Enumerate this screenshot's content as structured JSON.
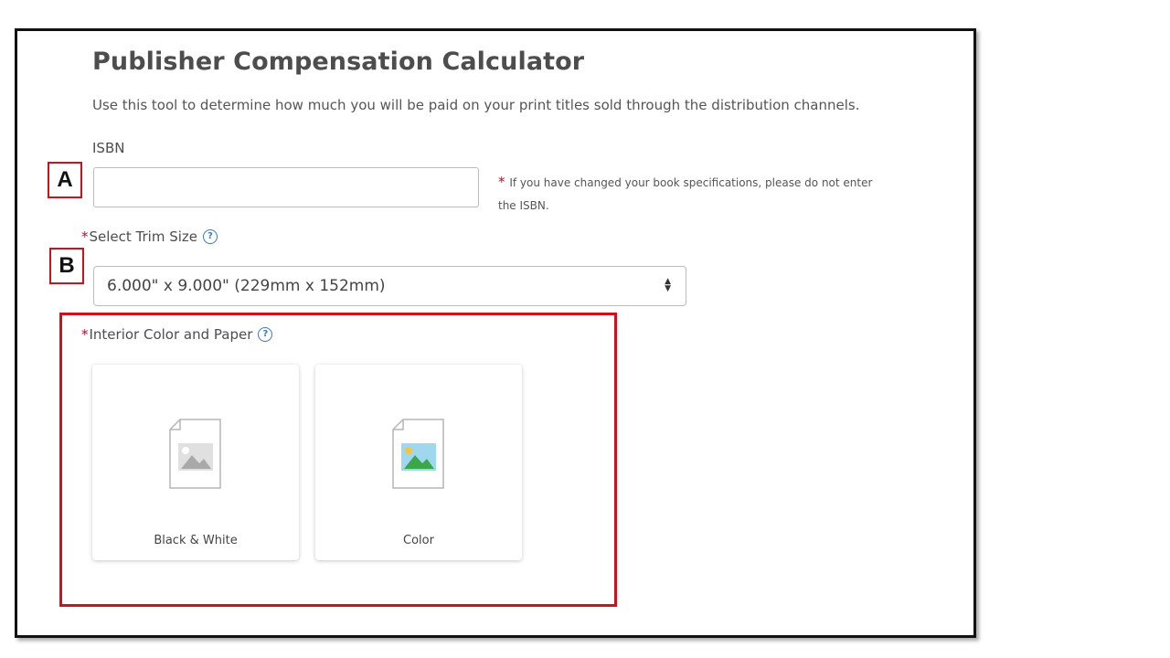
{
  "page": {
    "title": "Publisher Compensation Calculator",
    "description": "Use this tool to determine how much you will be paid on your print titles sold through the distribution channels."
  },
  "isbn": {
    "label": "ISBN",
    "value": "",
    "placeholder": "",
    "note_marker": "*",
    "note": "If you have changed your book specifications, please do not enter the ISBN."
  },
  "trim_size": {
    "required_marker": "*",
    "label": "Select Trim Size",
    "help_glyph": "?",
    "selected": "6.000\" x 9.000\" (229mm x 152mm)"
  },
  "interior": {
    "required_marker": "*",
    "label": "Interior Color and Paper",
    "help_glyph": "?",
    "options": [
      {
        "label": "Black & White",
        "icon": "grayscale-image-document-icon"
      },
      {
        "label": "Color",
        "icon": "color-image-document-icon"
      }
    ]
  },
  "annotations": {
    "marker_a": "A",
    "marker_b": "B",
    "highlight_color": "#d0101a"
  },
  "colors": {
    "required": "#b30e2f",
    "help": "#3a7bbf"
  }
}
